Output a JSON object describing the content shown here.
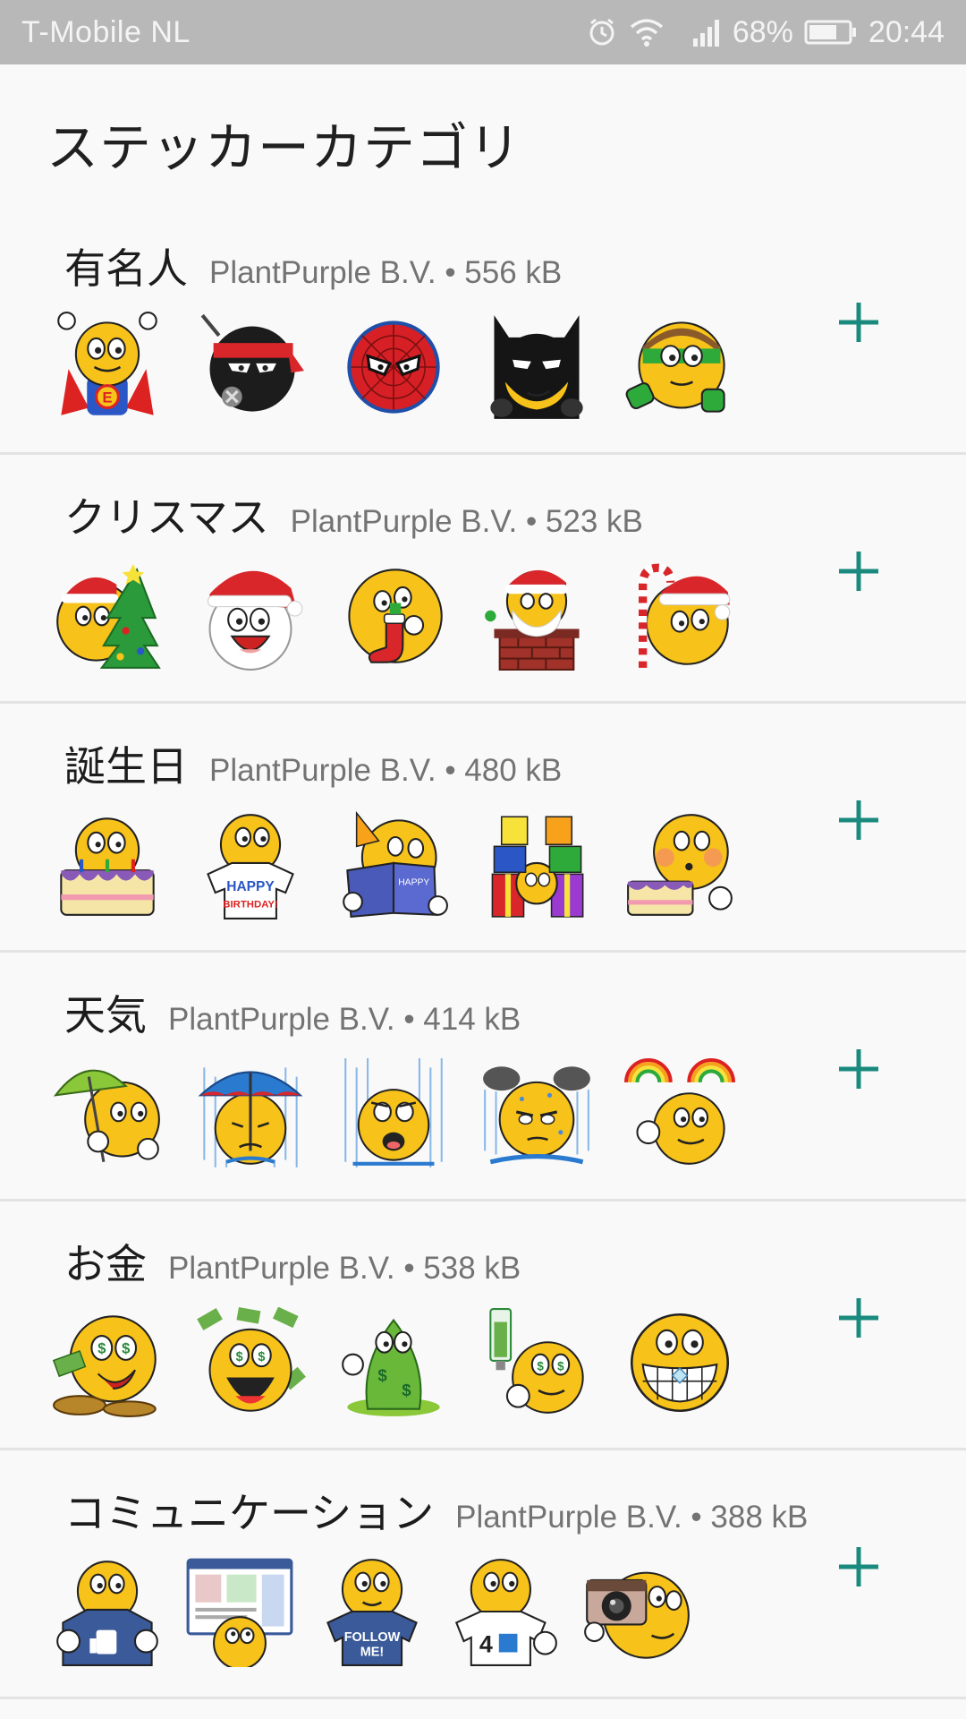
{
  "status_bar": {
    "carrier": "T-Mobile  NL",
    "battery": "68%",
    "time": "20:44",
    "icons": [
      "alarm-icon",
      "wifi-icon",
      "signal-icon",
      "battery-icon"
    ]
  },
  "page": {
    "title": "ステッカーカテゴリ"
  },
  "colors": {
    "accent": "#1a8a7e",
    "status_bar": "#b8b8b8",
    "sticker_face": "#f7c21a"
  },
  "categories": [
    {
      "name": "有名人",
      "meta": "PlantPurple B.V. • 556 kB",
      "stickers": [
        "superhero-smiley",
        "ninja-smiley",
        "spider-smiley",
        "bat-smiley",
        "ring-hero-smiley"
      ]
    },
    {
      "name": "クリスマス",
      "meta": "PlantPurple B.V. • 523 kB",
      "stickers": [
        "christmas-tree-smiley",
        "santa-beard-smiley",
        "stocking-smiley",
        "chimney-santa-smiley",
        "candy-cane-smiley"
      ]
    },
    {
      "name": "誕生日",
      "meta": "PlantPurple B.V. • 480 kB",
      "stickers": [
        "cake-smiley",
        "happy-birthday-shirt-smiley",
        "birthday-card-smiley",
        "gifts-smiley",
        "cake-blowing-smiley"
      ]
    },
    {
      "name": "天気",
      "meta": "PlantPurple B.V. • 414 kB",
      "stickers": [
        "green-umbrella-smiley",
        "rain-umbrella-smiley",
        "crying-rain-smiley",
        "storm-cloud-smiley",
        "rainbow-smiley"
      ]
    },
    {
      "name": "お金",
      "meta": "PlantPurple B.V. • 538 kB",
      "stickers": [
        "dollar-eyes-smiley",
        "money-rain-smiley",
        "green-money-smiley",
        "money-bottle-smiley",
        "diamond-teeth-smiley"
      ]
    },
    {
      "name": "コミュニケーション",
      "meta": "PlantPurple B.V. • 388 kB",
      "stickers": [
        "thumbs-up-shirt-smiley",
        "website-smiley",
        "follow-me-smiley",
        "foursquare-smiley",
        "camera-smiley"
      ],
      "sticker_texts": {
        "follow_me": "FOLLOW ME!"
      }
    }
  ]
}
